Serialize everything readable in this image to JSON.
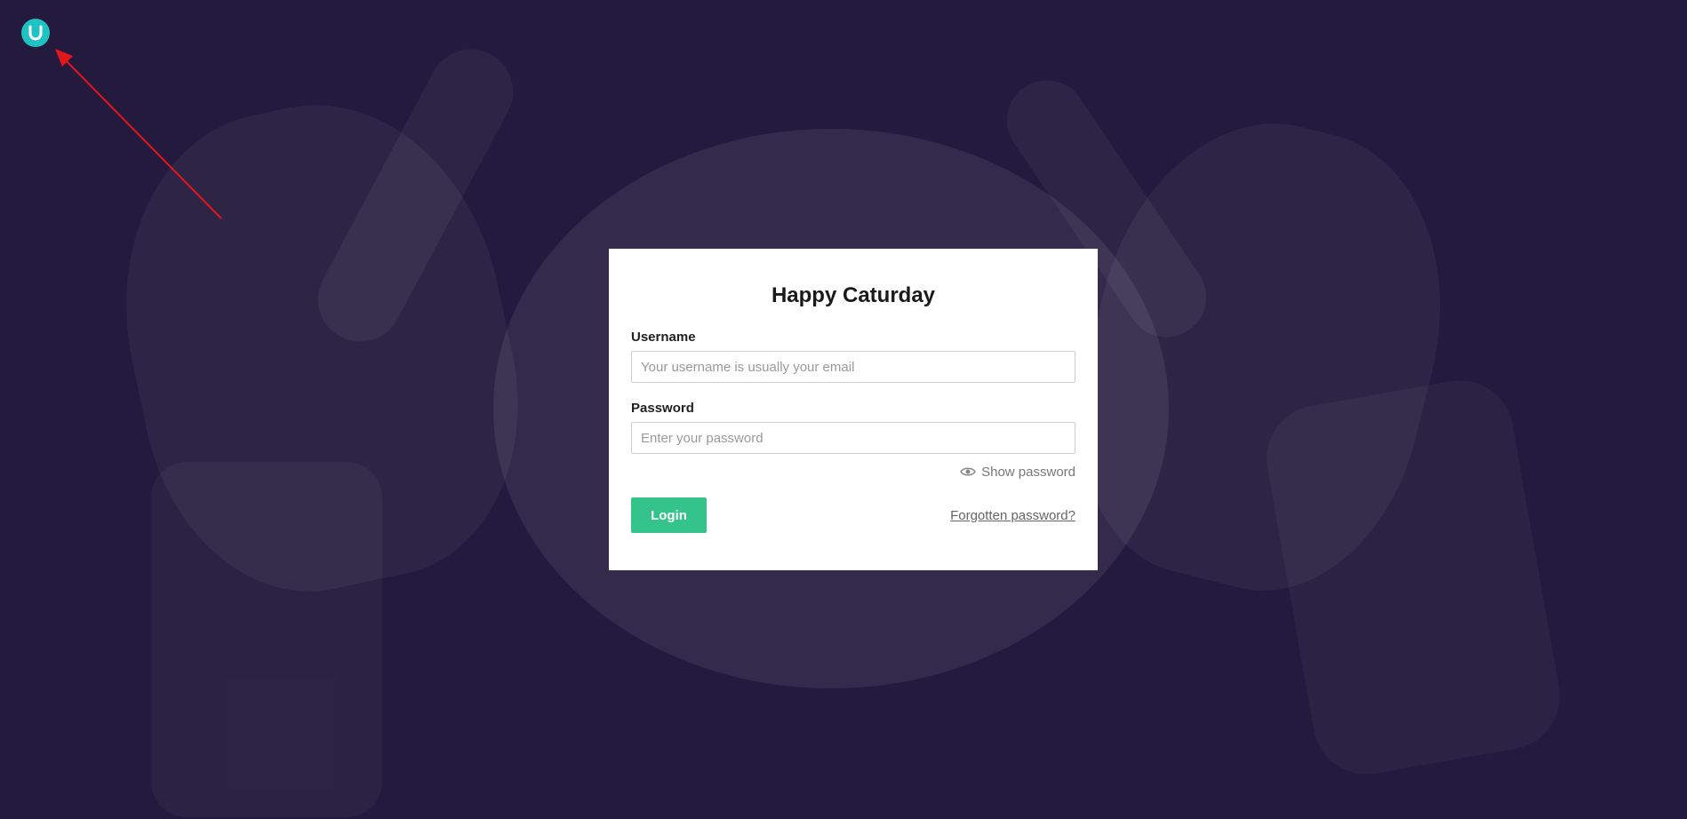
{
  "login": {
    "title": "Happy Caturday",
    "username_label": "Username",
    "username_placeholder": "Your username is usually your email",
    "password_label": "Password",
    "password_placeholder": "Enter your password",
    "show_password_label": "Show password",
    "login_button_label": "Login",
    "forgot_password_label": "Forgotten password?"
  },
  "icons": {
    "logo": "brand-logo-icon",
    "show_password": "eye-icon",
    "annotation": "red-arrow-icon"
  },
  "colors": {
    "background": "#231a3d",
    "logo": "#1ec2c2",
    "login_button": "#34c38a",
    "annotation_arrow": "#e3161b"
  }
}
